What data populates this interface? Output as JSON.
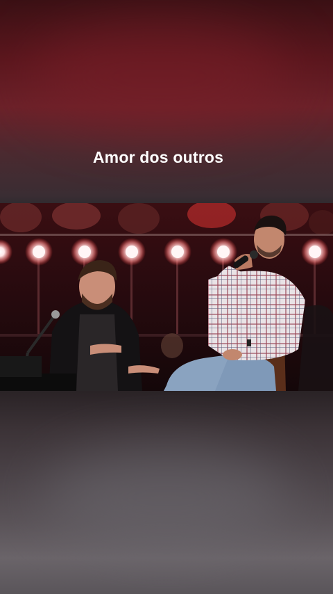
{
  "overlay": {
    "title": "Amor dos outros"
  },
  "video": {
    "scene": "video-frame"
  }
}
